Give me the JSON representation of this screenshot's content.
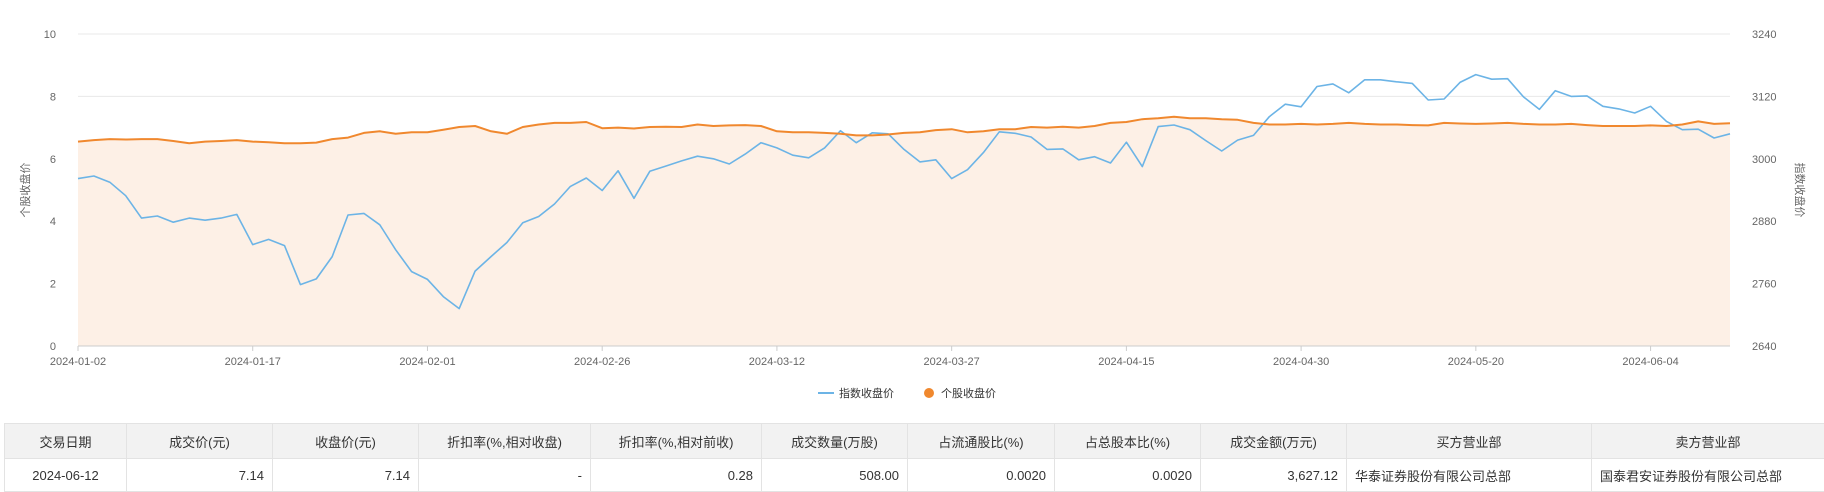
{
  "chart_data": {
    "type": "line",
    "x": [
      "2024-01-02",
      "2024-01-03",
      "2024-01-04",
      "2024-01-05",
      "2024-01-08",
      "2024-01-09",
      "2024-01-10",
      "2024-01-11",
      "2024-01-12",
      "2024-01-15",
      "2024-01-16",
      "2024-01-17",
      "2024-01-18",
      "2024-01-19",
      "2024-01-22",
      "2024-01-23",
      "2024-01-24",
      "2024-01-25",
      "2024-01-26",
      "2024-01-29",
      "2024-01-30",
      "2024-01-31",
      "2024-02-01",
      "2024-02-02",
      "2024-02-05",
      "2024-02-06",
      "2024-02-07",
      "2024-02-08",
      "2024-02-19",
      "2024-02-20",
      "2024-02-21",
      "2024-02-22",
      "2024-02-23",
      "2024-02-26",
      "2024-02-27",
      "2024-02-28",
      "2024-02-29",
      "2024-03-01",
      "2024-03-04",
      "2024-03-05",
      "2024-03-06",
      "2024-03-07",
      "2024-03-08",
      "2024-03-11",
      "2024-03-12",
      "2024-03-13",
      "2024-03-14",
      "2024-03-15",
      "2024-03-18",
      "2024-03-19",
      "2024-03-20",
      "2024-03-21",
      "2024-03-22",
      "2024-03-25",
      "2024-03-26",
      "2024-03-27",
      "2024-03-28",
      "2024-03-29",
      "2024-04-01",
      "2024-04-02",
      "2024-04-03",
      "2024-04-08",
      "2024-04-09",
      "2024-04-10",
      "2024-04-11",
      "2024-04-12",
      "2024-04-15",
      "2024-04-16",
      "2024-04-17",
      "2024-04-18",
      "2024-04-19",
      "2024-04-22",
      "2024-04-23",
      "2024-04-24",
      "2024-04-25",
      "2024-04-26",
      "2024-04-29",
      "2024-04-30",
      "2024-05-06",
      "2024-05-07",
      "2024-05-08",
      "2024-05-09",
      "2024-05-10",
      "2024-05-13",
      "2024-05-14",
      "2024-05-15",
      "2024-05-16",
      "2024-05-17",
      "2024-05-20",
      "2024-05-21",
      "2024-05-22",
      "2024-05-23",
      "2024-05-24",
      "2024-05-27",
      "2024-05-28",
      "2024-05-29",
      "2024-05-30",
      "2024-05-31",
      "2024-06-03",
      "2024-06-04",
      "2024-06-05",
      "2024-06-06",
      "2024-06-07",
      "2024-06-11",
      "2024-06-12"
    ],
    "xticks": [
      "2024-01-02",
      "2024-01-17",
      "2024-02-01",
      "2024-02-26",
      "2024-03-12",
      "2024-03-27",
      "2024-04-15",
      "2024-04-30",
      "2024-05-20",
      "2024-06-04"
    ],
    "series": [
      {
        "name": "个股收盘价",
        "axis": "left",
        "color": "#f0882e",
        "area_fill": "#fdf0e6",
        "values": [
          6.55,
          6.6,
          6.63,
          6.62,
          6.63,
          6.63,
          6.57,
          6.5,
          6.55,
          6.57,
          6.6,
          6.55,
          6.53,
          6.5,
          6.5,
          6.52,
          6.63,
          6.68,
          6.83,
          6.88,
          6.8,
          6.85,
          6.85,
          6.93,
          7.02,
          7.05,
          6.88,
          6.8,
          7.02,
          7.1,
          7.15,
          7.15,
          7.18,
          6.98,
          7.0,
          6.97,
          7.02,
          7.03,
          7.02,
          7.1,
          7.05,
          7.07,
          7.08,
          7.05,
          6.88,
          6.85,
          6.85,
          6.83,
          6.8,
          6.75,
          6.75,
          6.78,
          6.83,
          6.85,
          6.92,
          6.95,
          6.85,
          6.88,
          6.95,
          6.95,
          7.02,
          7.0,
          7.03,
          7.0,
          7.05,
          7.15,
          7.18,
          7.27,
          7.3,
          7.35,
          7.3,
          7.3,
          7.27,
          7.25,
          7.15,
          7.1,
          7.1,
          7.12,
          7.1,
          7.12,
          7.15,
          7.12,
          7.1,
          7.1,
          7.08,
          7.07,
          7.15,
          7.13,
          7.12,
          7.13,
          7.15,
          7.12,
          7.1,
          7.1,
          7.12,
          7.08,
          7.05,
          7.05,
          7.05,
          7.07,
          7.05,
          7.1,
          7.2,
          7.12,
          7.14
        ]
      },
      {
        "name": "指数收盘价",
        "axis": "right",
        "color": "#6cb4e6",
        "values": [
          2962,
          2967,
          2955,
          2929,
          2886,
          2890,
          2878,
          2886,
          2882,
          2886,
          2893,
          2835,
          2845,
          2833,
          2758,
          2769,
          2812,
          2892,
          2895,
          2873,
          2825,
          2783,
          2768,
          2735,
          2712,
          2784,
          2812,
          2839,
          2877,
          2889,
          2913,
          2947,
          2963,
          2939,
          2977,
          2924,
          2976,
          2986,
          2996,
          3005,
          3000,
          2990,
          3009,
          3031,
          3021,
          3007,
          3002,
          3021,
          3054,
          3031,
          3050,
          3048,
          3018,
          2994,
          2998,
          2962,
          2979,
          3012,
          3052,
          3049,
          3042,
          3018,
          3019,
          2998,
          3004,
          2992,
          3032,
          2985,
          3062,
          3065,
          3056,
          3035,
          3015,
          3036,
          3045,
          3081,
          3105,
          3100,
          3139,
          3144,
          3127,
          3152,
          3152,
          3148,
          3145,
          3113,
          3115,
          3147,
          3162,
          3153,
          3154,
          3119,
          3095,
          3131,
          3120,
          3121,
          3101,
          3096,
          3088,
          3101,
          3072,
          3056,
          3057,
          3040,
          3048
        ]
      }
    ],
    "left_axis": {
      "label": "个股收盘价",
      "ylim": [
        0,
        10
      ],
      "ticks": [
        0,
        2,
        4,
        6,
        8,
        10
      ]
    },
    "right_axis": {
      "label": "指数收盘价",
      "ylim": [
        2640,
        3240
      ],
      "ticks": [
        2640,
        2760,
        2880,
        3000,
        3120,
        3240
      ]
    },
    "grid": true,
    "legend_position": "bottom-center"
  },
  "legend": {
    "index_label": "指数收盘价",
    "stock_label": "个股收盘价"
  },
  "table": {
    "headers": [
      "交易日期",
      "成交价(元)",
      "收盘价(元)",
      "折扣率(%,相对收盘)",
      "折扣率(%,相对前收)",
      "成交数量(万股)",
      "占流通股比(%)",
      "占总股本比(%)",
      "成交金额(万元)",
      "买方营业部",
      "卖方营业部"
    ],
    "rows": [
      [
        "2024-06-12",
        "7.14",
        "7.14",
        "-",
        "0.28",
        "508.00",
        "0.0020",
        "0.0020",
        "3,627.12",
        "华泰证券股份有限公司总部",
        "国泰君安证券股份有限公司总部"
      ]
    ]
  }
}
